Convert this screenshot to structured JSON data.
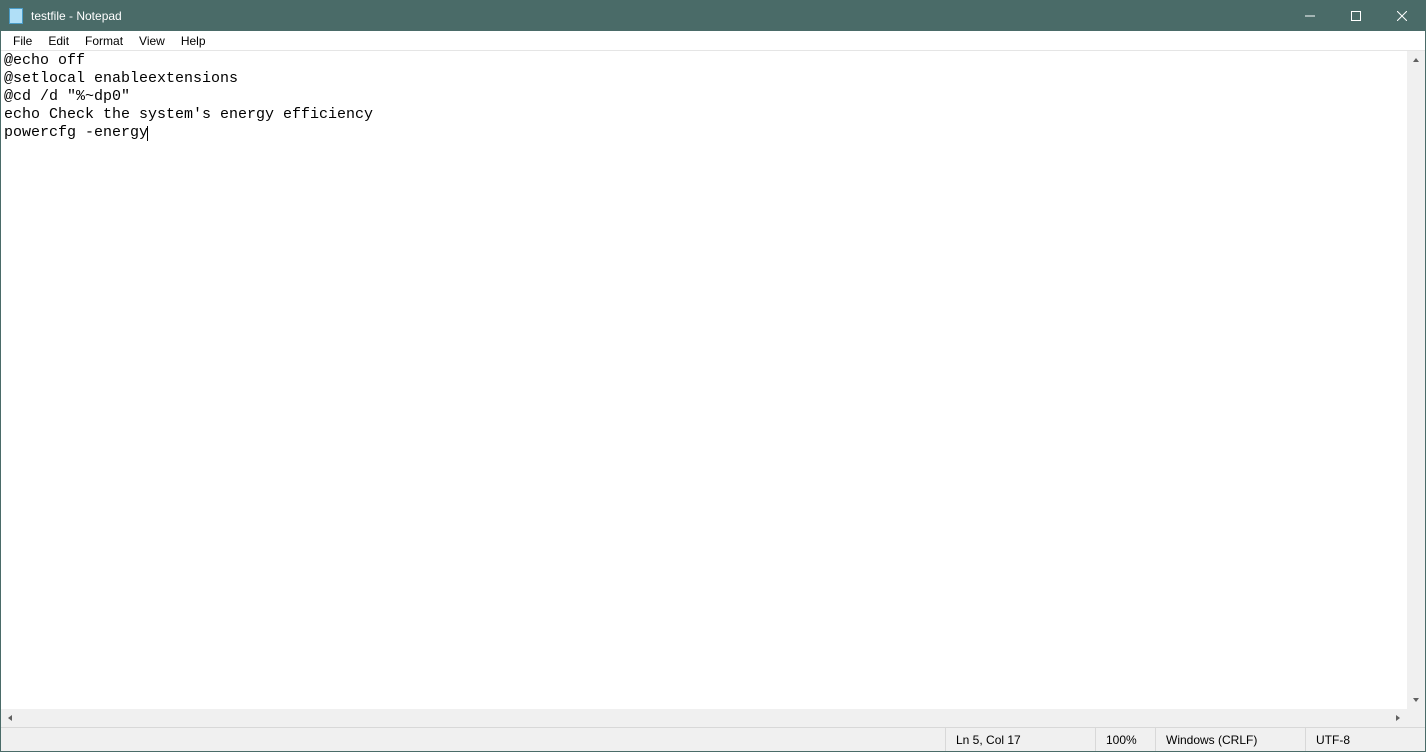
{
  "window": {
    "title": "testfile - Notepad"
  },
  "menu": {
    "file": "File",
    "edit": "Edit",
    "format": "Format",
    "view": "View",
    "help": "Help"
  },
  "editor": {
    "content": "@echo off\n@setlocal enableextensions\n@cd /d \"%~dp0\"\necho Check the system's energy efficiency\npowercfg -energy"
  },
  "status": {
    "position": "Ln 5, Col 17",
    "zoom": "100%",
    "eol": "Windows (CRLF)",
    "encoding": "UTF-8"
  }
}
